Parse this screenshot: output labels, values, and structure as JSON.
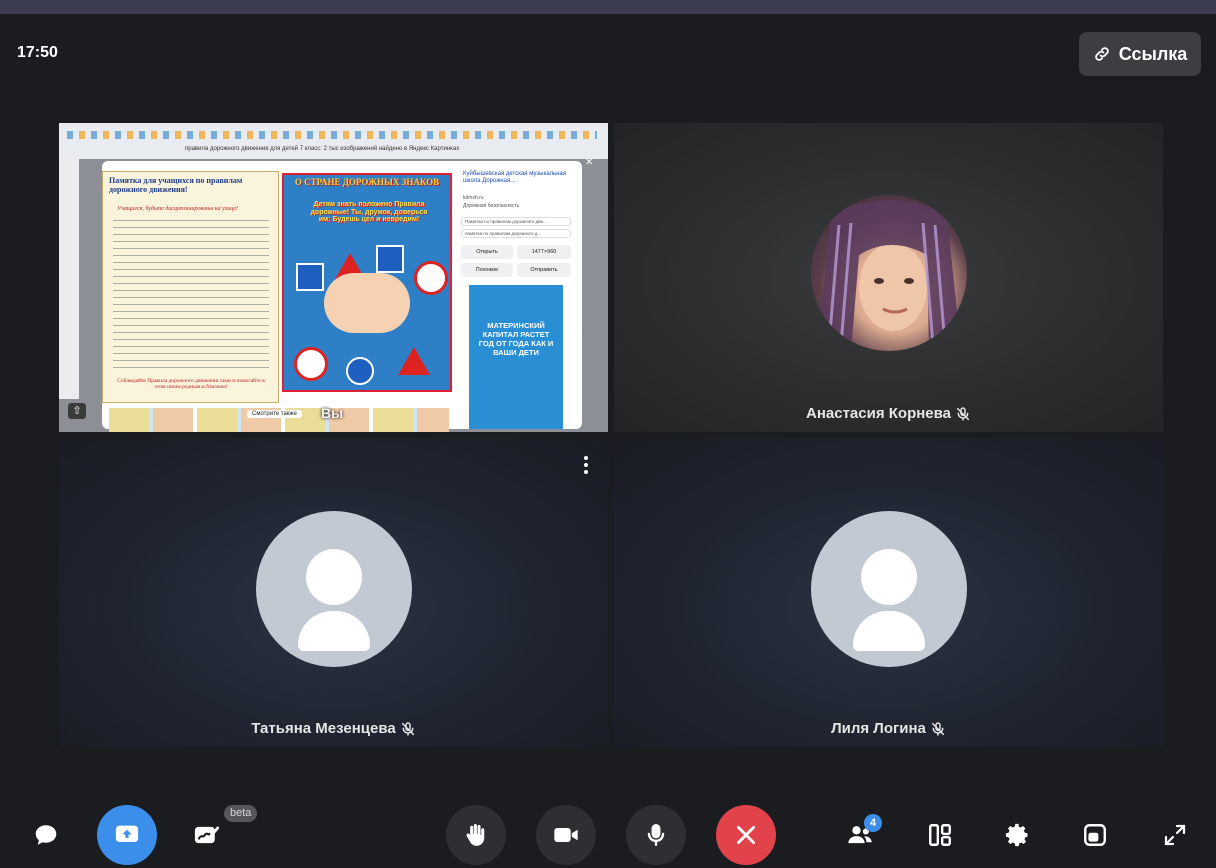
{
  "header": {
    "time": "17:50",
    "link_button_label": "Ссылка"
  },
  "participants": [
    {
      "name": "Вы",
      "type": "screen-share"
    },
    {
      "name": "Анастасия Корнева",
      "muted": true,
      "type": "photo"
    },
    {
      "name": "Татьяна Мезенцева",
      "muted": true,
      "type": "placeholder"
    },
    {
      "name": "Лиля Логина",
      "muted": true,
      "type": "placeholder"
    }
  ],
  "shared_screen": {
    "url_text": "правила дорожного движения для детей 7 класс: 2 тыс изображений найдено в Яндекс Картинках",
    "memo_title": "Памятка для учащихся по правилам дорожного движения!",
    "memo_subtitle": "Учащиеся, будьте дисциплинированы на улице!",
    "memo_footer": "Соблюдайте Правила дорожного движения сами и помогайте в этом своим родным и близким!",
    "poster_title": "О СТРАНЕ ДОРОЖНЫХ ЗНАКОВ",
    "poster_text": "Детям знать положено Правила дорожные! Ты, дружок, доверься им: Будешь цел и невредим!",
    "source_title": "Куйбышевская детская музыкальная школа Дорожная...",
    "source_site": "kdmsh.ru",
    "source_category": "Дорожная безопасность",
    "search_suggestion_1": "Памятка по правилам дорожного дви...",
    "search_suggestion_2": "памятка по правилам дорожного д...",
    "open_button": "Открыть",
    "size_label": "1477×960",
    "similar_button": "Похожие",
    "send_button": "Отправить",
    "ad_title": "МАТЕРИНСКИЙ КАПИТАЛ РАСТЕТ ГОД ОТ ГОДА КАК И ВАШИ ДЕТИ",
    "see_also": "Смотрите также"
  },
  "controls": {
    "beta_label": "beta",
    "participants_count": "4"
  },
  "colors": {
    "accent": "#3b8fea",
    "hangup": "#e2424a",
    "background": "#1b1c1f"
  }
}
